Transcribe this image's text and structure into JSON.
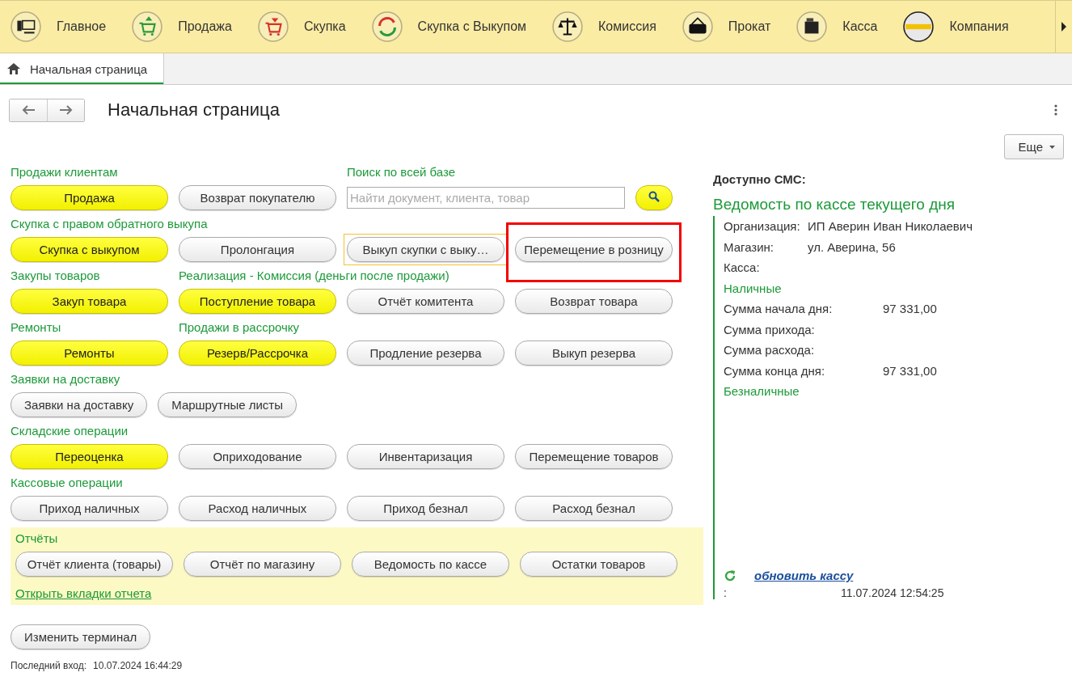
{
  "nav": [
    {
      "label": "Главное"
    },
    {
      "label": "Продажа"
    },
    {
      "label": "Скупка"
    },
    {
      "label": "Скупка с Выкупом"
    },
    {
      "label": "Комиссия"
    },
    {
      "label": "Прокат"
    },
    {
      "label": "Касса"
    },
    {
      "label": "Компания"
    }
  ],
  "tabs": [
    {
      "label": "Начальная страница",
      "selected": true
    }
  ],
  "page": {
    "title": "Начальная страница",
    "more_button": "Еще"
  },
  "rows": [
    {
      "groups": [
        {
          "title": "Продажи клиентам",
          "kind": "buttons",
          "buttons": [
            {
              "label": "Продажа",
              "primary": true
            },
            {
              "label": "Возврат покупателю",
              "primary": false
            }
          ]
        },
        {
          "title": "Поиск по всей базе",
          "kind": "search",
          "placeholder": "Найти документ, клиента, товар"
        }
      ]
    },
    {
      "groups": [
        {
          "title": "Скупка с правом обратного выкупа",
          "kind": "buttons",
          "buttons": [
            {
              "label": "Скупка с выкупом",
              "primary": true
            },
            {
              "label": "Пролонгация",
              "primary": false
            },
            {
              "label": "Выкуп скупки с выку…",
              "primary": false,
              "focused": true
            },
            {
              "label": "Перемещение в розницу",
              "primary": false,
              "highlighted": true
            }
          ]
        }
      ]
    },
    {
      "groups": [
        {
          "title": "Закупы товаров",
          "kind": "buttons",
          "buttons": [
            {
              "label": "Закуп товара",
              "primary": true
            }
          ]
        },
        {
          "title": "Реализация - Комиссия (деньги после продажи)",
          "kind": "buttons",
          "buttons": [
            {
              "label": "Поступление товара",
              "primary": true
            },
            {
              "label": "Отчёт комитента",
              "primary": false
            },
            {
              "label": "Возврат товара",
              "primary": false
            }
          ]
        }
      ]
    },
    {
      "groups": [
        {
          "title": "Ремонты",
          "kind": "buttons",
          "buttons": [
            {
              "label": "Ремонты",
              "primary": true
            }
          ]
        },
        {
          "title": "Продажи в рассрочку",
          "kind": "buttons",
          "buttons": [
            {
              "label": "Резерв/Рассрочка",
              "primary": true
            },
            {
              "label": "Продление резерва",
              "primary": false
            },
            {
              "label": "Выкуп резерва",
              "primary": false
            }
          ]
        }
      ]
    },
    {
      "groups": [
        {
          "title": "Заявки на доставку",
          "kind": "compact",
          "buttons": [
            {
              "label": "Заявки на доставку",
              "primary": false
            },
            {
              "label": "Маршрутные листы",
              "primary": false
            }
          ]
        }
      ]
    },
    {
      "groups": [
        {
          "title": "Складские операции",
          "kind": "buttons",
          "buttons": [
            {
              "label": "Переоценка",
              "primary": true
            },
            {
              "label": "Оприходование",
              "primary": false
            },
            {
              "label": "Инвентаризация",
              "primary": false
            },
            {
              "label": "Перемещение товаров",
              "primary": false
            }
          ]
        }
      ]
    },
    {
      "groups": [
        {
          "title": "Кассовые операции",
          "kind": "buttons",
          "buttons": [
            {
              "label": "Приход наличных",
              "primary": false
            },
            {
              "label": "Расход наличных",
              "primary": false
            },
            {
              "label": "Приход безнал",
              "primary": false
            },
            {
              "label": "Расход безнал",
              "primary": false
            }
          ]
        }
      ]
    }
  ],
  "reports": {
    "title": "Отчёты",
    "buttons": [
      "Отчёт клиента (товары)",
      "Отчёт по магазину",
      "Ведомость по кассе",
      "Остатки товаров"
    ],
    "link": "Открыть вкладки отчета"
  },
  "terminal_button": "Изменить терминал",
  "last_login": {
    "label": "Последний вход:",
    "value": "10.07.2024 16:44:29"
  },
  "sms": {
    "label": "Доступно СМС:"
  },
  "cash_report": {
    "title": "Ведомость по кассе текущего дня",
    "lines": [
      {
        "kind": "field",
        "label": "Организация:",
        "value": "ИП Аверин Иван Николаевич"
      },
      {
        "kind": "field",
        "label": "Магазин:",
        "value": "ул. Аверина, 56"
      },
      {
        "kind": "field",
        "label": "Касса:"
      },
      {
        "kind": "section",
        "label": "Наличные"
      },
      {
        "kind": "sum",
        "label": "Сумма начала дня:",
        "value": "97 331,00"
      },
      {
        "kind": "sum",
        "label": "Сумма прихода:"
      },
      {
        "kind": "sum",
        "label": "Сумма расхода:"
      },
      {
        "kind": "sum",
        "label": "Сумма конца дня:",
        "value": "97 331,00"
      },
      {
        "kind": "section",
        "label": "Безналичные"
      }
    ],
    "refresh_link": "обновить кассу",
    "updated_label": ":",
    "updated_value": "11.07.2024 12:54:25"
  }
}
